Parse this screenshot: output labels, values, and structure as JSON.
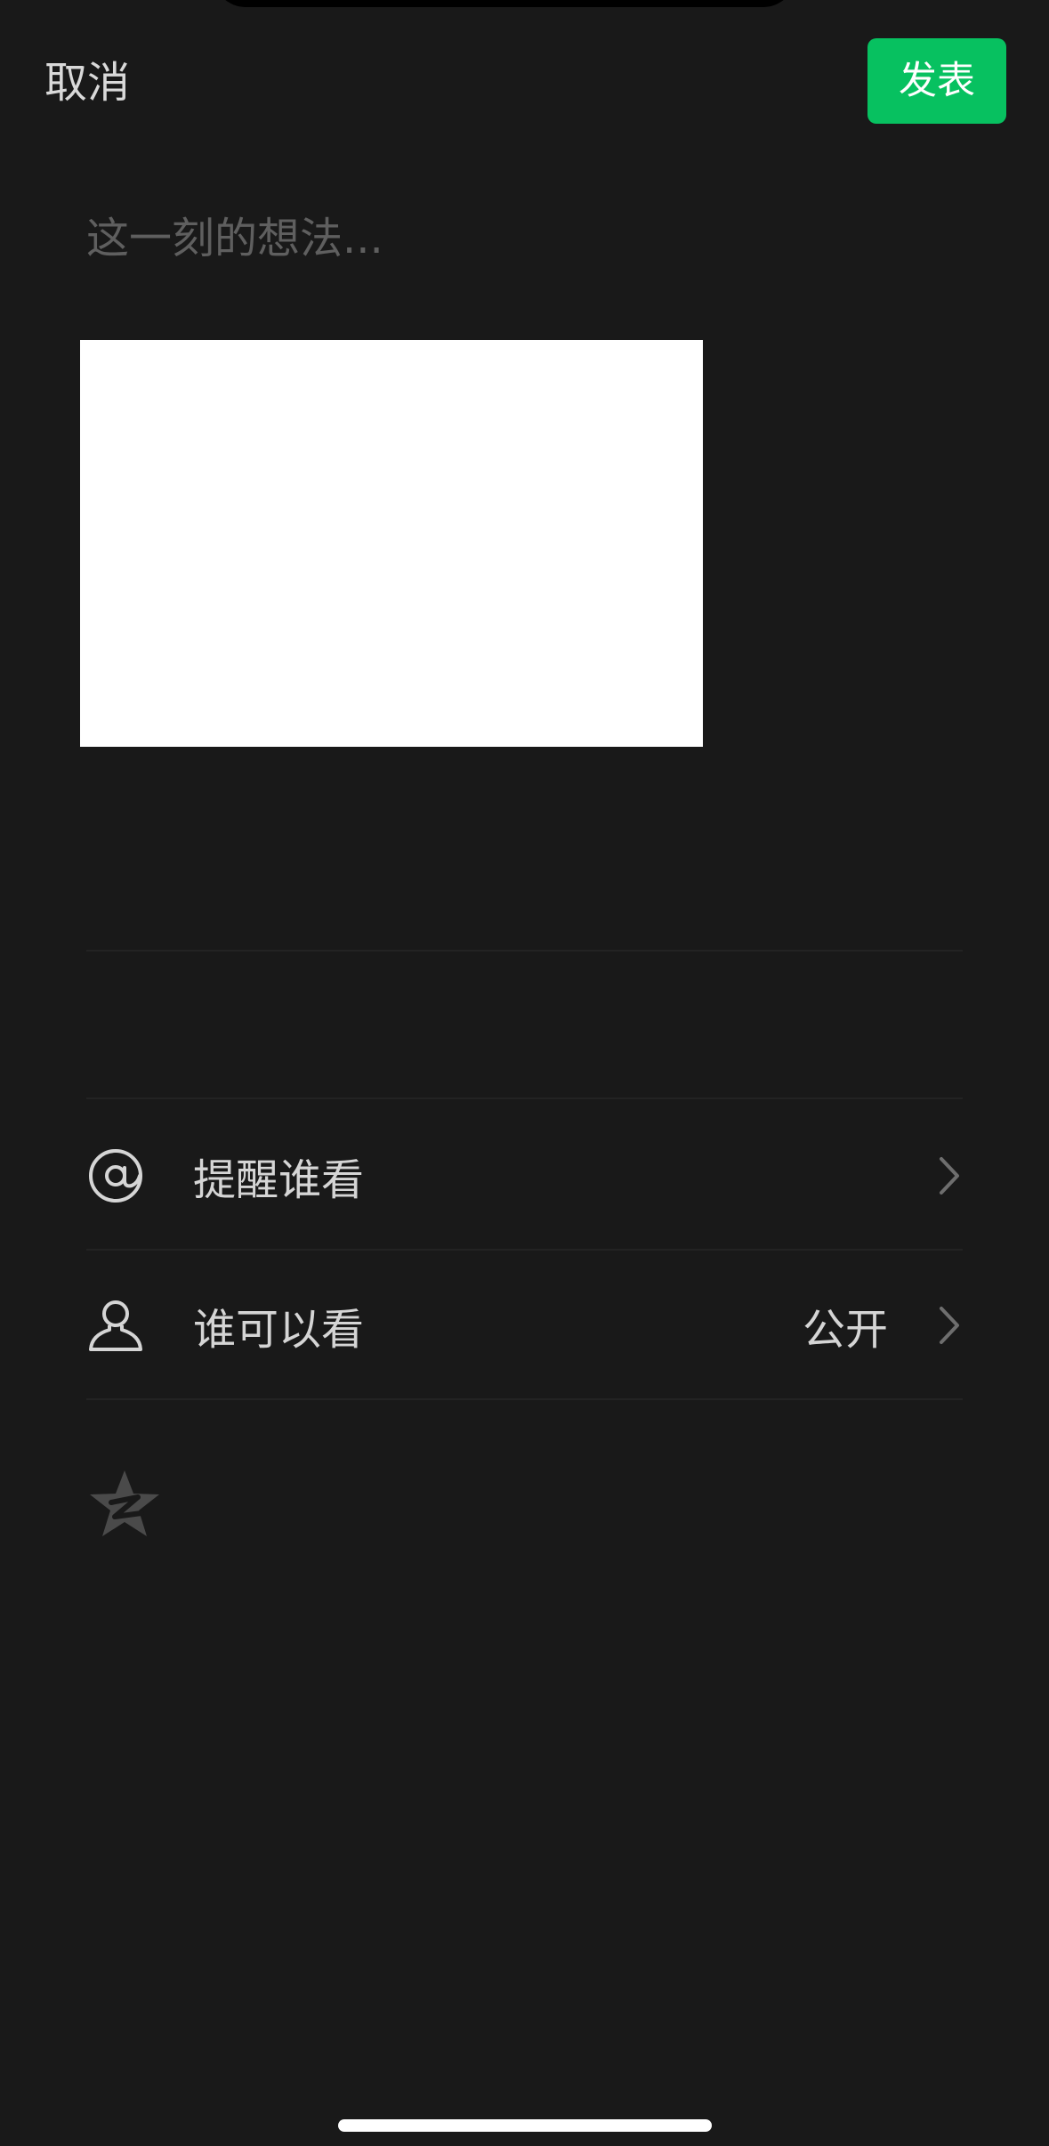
{
  "header": {
    "cancel_label": "取消",
    "publish_label": "发表",
    "publish_color": "#07c160"
  },
  "composer": {
    "placeholder": "这一刻的想法..."
  },
  "options": [
    {
      "icon": "at-icon",
      "label": "提醒谁看",
      "value": ""
    },
    {
      "icon": "person-icon",
      "label": "谁可以看",
      "value": "公开"
    }
  ],
  "share_targets": [
    {
      "icon": "qzone-icon"
    }
  ],
  "colors": {
    "background": "#191919",
    "text": "#d5d5d5",
    "placeholder": "#5f5f5f"
  }
}
